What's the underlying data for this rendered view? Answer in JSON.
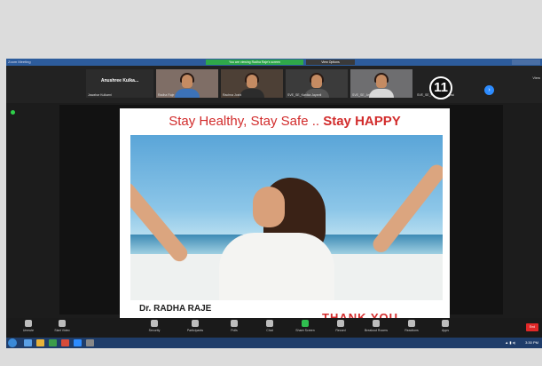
{
  "window": {
    "app_title": "Zoom Meeting",
    "recording_banner": "You are viewing Radha Raje's screen",
    "view_options": "View Options"
  },
  "participants": [
    {
      "name": "Jawahar Kulkarni",
      "display_text": "Anushree Kulka...",
      "type": "name-only"
    },
    {
      "name": "Radha Raje",
      "type": "video"
    },
    {
      "name": "Rachna Joshi",
      "type": "video"
    },
    {
      "name": "SVE_SE_Kanika Jayanti",
      "type": "video"
    },
    {
      "name": "SVE_SE_Arti Yadav",
      "type": "video"
    },
    {
      "name": "SVE_SE_Prasoon Sanyasi",
      "type": "count"
    }
  ],
  "hidden_participant_count": "11",
  "corner_label": "View",
  "slide": {
    "title_part1": "Stay Healthy, Stay Safe .. ",
    "title_part2": "Stay HAPPY",
    "author": "Dr. RADHA RAJE",
    "footer_text": "THANK YOU"
  },
  "toolbar": {
    "items": [
      {
        "label": "Unmute",
        "icon": "microphone-icon"
      },
      {
        "label": "Start Video",
        "icon": "video-camera-icon"
      },
      {
        "label": "Security",
        "icon": "shield-icon"
      },
      {
        "label": "Participants",
        "icon": "people-icon"
      },
      {
        "label": "Polls",
        "icon": "poll-icon"
      },
      {
        "label": "Chat",
        "icon": "chat-icon"
      },
      {
        "label": "Share Screen",
        "icon": "share-screen-icon"
      },
      {
        "label": "Record",
        "icon": "record-icon"
      },
      {
        "label": "Breakout Rooms",
        "icon": "breakout-rooms-icon"
      },
      {
        "label": "Reactions",
        "icon": "reactions-icon"
      },
      {
        "label": "Apps",
        "icon": "apps-icon"
      }
    ],
    "end_label": "End"
  },
  "taskbar": {
    "clock": "3:30 PM"
  },
  "colors": {
    "title_red": "#d22c2c",
    "zoom_blue": "#2d8cff",
    "share_green": "#2fbe4f",
    "end_red": "#e02828"
  }
}
